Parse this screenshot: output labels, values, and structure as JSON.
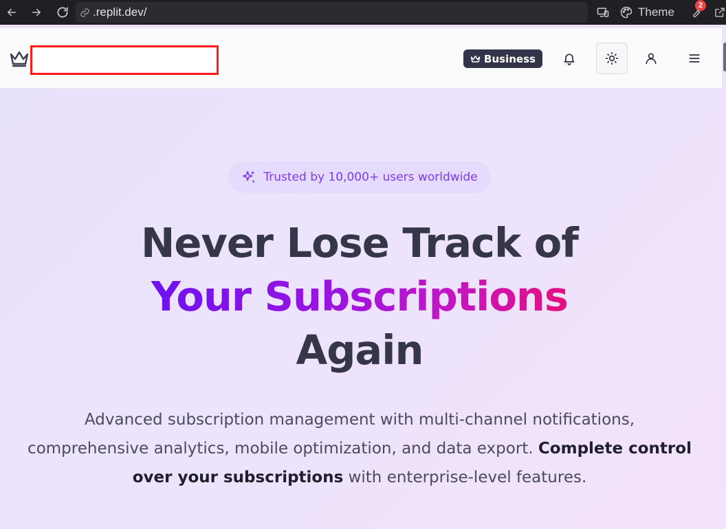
{
  "browser": {
    "url": ".replit.dev/",
    "theme_label": "Theme",
    "notification_count": "2"
  },
  "header": {
    "business_label": "Business"
  },
  "hero": {
    "trust_badge": "Trusted by 10,000+ users worldwide",
    "headline_line1": "Never Lose Track of",
    "headline_line2": "Your Subscriptions",
    "headline_line3": "Again",
    "description_part1": "Advanced subscription management with multi-channel notifications, comprehensive analytics, mobile optimization, and data export. ",
    "description_bold": "Complete control over your subscriptions",
    "description_part2": " with enterprise-level features."
  },
  "colors": {
    "accent_purple": "#7c3aed",
    "gradient_start": "#6d12f0",
    "gradient_end": "#e5107f",
    "header_dark": "#33334a",
    "redaction_border": "#ff1a1a"
  },
  "icons": [
    "back-icon",
    "forward-icon",
    "reload-icon",
    "link-icon",
    "devices-icon",
    "palette-icon",
    "wrench-icon",
    "popout-icon",
    "crown-icon",
    "bell-icon",
    "sun-icon",
    "user-icon",
    "menu-icon",
    "sparkle-icon"
  ]
}
